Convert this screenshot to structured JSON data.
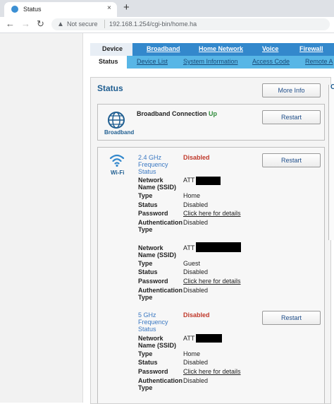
{
  "browser": {
    "tab_title": "Status",
    "tab_close": "×",
    "new_tab": "+",
    "not_secure": "Not secure",
    "url": "192.168.1.254/cgi-bin/home.ha"
  },
  "nav_primary": {
    "active": "Device",
    "items": [
      "Broadband",
      "Home Network",
      "Voice",
      "Firewall"
    ]
  },
  "nav_secondary": {
    "active": "Status",
    "items": [
      "Device List",
      "System Information",
      "Access Code",
      "Remote A"
    ]
  },
  "status": {
    "title": "Status",
    "more_info_button": "More Info",
    "right_edge_char": "C"
  },
  "broadband": {
    "icon_label": "Broadband",
    "label": "Broadband Connection",
    "state": "Up",
    "restart_button": "Restart"
  },
  "wifi": {
    "icon_label": "Wi-Fi",
    "band_24": {
      "title": "2.4 GHz Frequency Status",
      "state": "Disabled",
      "restart_button": "Restart",
      "networks": [
        {
          "network_name_label": "Network Name (SSID)",
          "network_name_value": "ATT",
          "type_label": "Type",
          "type_value": "Home",
          "status_label": "Status",
          "status_value": "Disabled",
          "password_label": "Password",
          "password_link": "Click here for details",
          "auth_label": "Authentication Type",
          "auth_value": "Disabled"
        },
        {
          "network_name_label": "Network Name (SSID)",
          "network_name_value": "ATT",
          "type_label": "Type",
          "type_value": "Guest",
          "status_label": "Status",
          "status_value": "Disabled",
          "password_label": "Password",
          "password_link": "Click here for details",
          "auth_label": "Authentication Type",
          "auth_value": "Disabled"
        }
      ]
    },
    "band_5": {
      "title": "5 GHz Frequency Status",
      "state": "Disabled",
      "restart_button": "Restart",
      "network": {
        "network_name_label": "Network Name (SSID)",
        "network_name_value": "ATT",
        "type_label": "Type",
        "type_value": "Home",
        "status_label": "Status",
        "status_value": "Disabled",
        "password_label": "Password",
        "password_link": "Click here for details",
        "auth_label": "Authentication Type",
        "auth_value": "Disabled"
      }
    }
  }
}
